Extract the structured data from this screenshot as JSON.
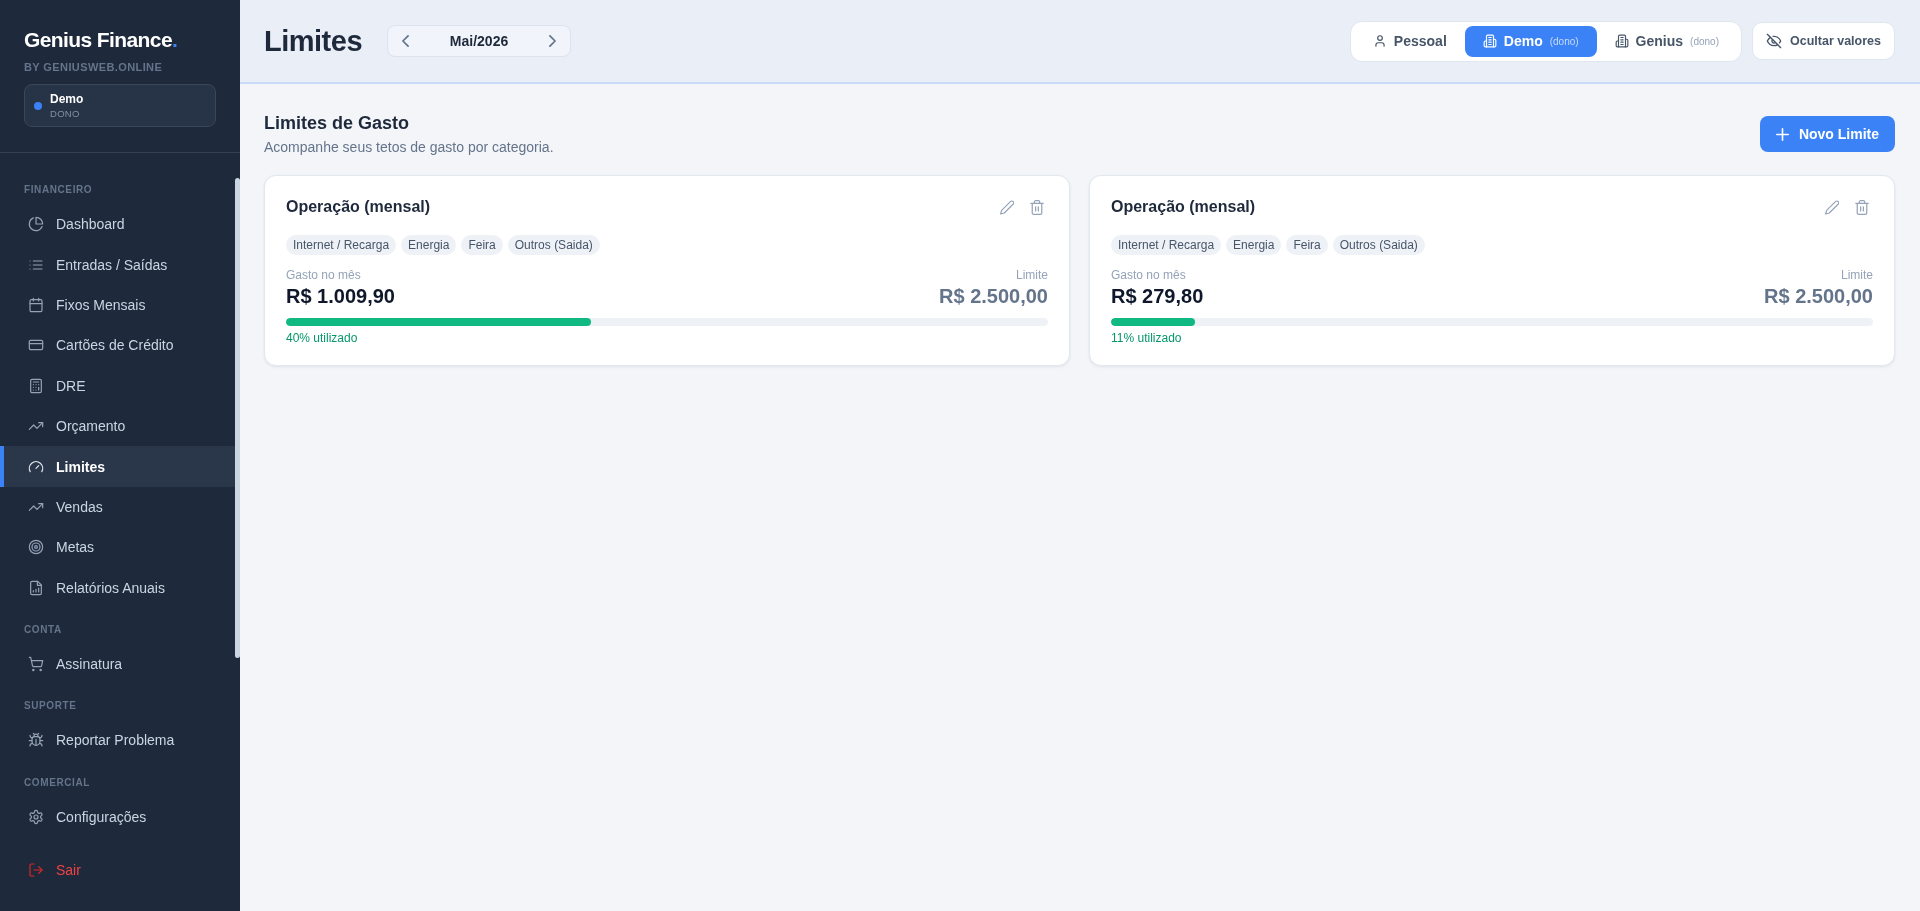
{
  "sidebar": {
    "brand": "Genius Finance",
    "brand_accent": ".",
    "tagline": "BY GENIUSWEB.ONLINE",
    "workspace": {
      "name": "Demo",
      "role": "DONO"
    },
    "sections": [
      {
        "title": "FINANCEIRO",
        "items": [
          {
            "label": "Dashboard",
            "selected": false
          },
          {
            "label": "Entradas / Saídas",
            "selected": false
          },
          {
            "label": "Fixos Mensais",
            "selected": false
          },
          {
            "label": "Cartões de Crédito",
            "selected": false
          },
          {
            "label": "DRE",
            "selected": false
          },
          {
            "label": "Orçamento",
            "selected": false
          },
          {
            "label": "Limites",
            "selected": true
          },
          {
            "label": "Vendas",
            "selected": false
          },
          {
            "label": "Metas",
            "selected": false
          },
          {
            "label": "Relatórios Anuais",
            "selected": false
          }
        ]
      },
      {
        "title": "CONTA",
        "items": [
          {
            "label": "Assinatura",
            "selected": false
          }
        ]
      },
      {
        "title": "SUPORTE",
        "items": [
          {
            "label": "Reportar Problema",
            "selected": false
          }
        ]
      },
      {
        "title": "COMERCIAL",
        "items": [
          {
            "label": "Configurações",
            "selected": false
          }
        ]
      }
    ],
    "logout": "Sair"
  },
  "header": {
    "title": "Limites",
    "month": "Mai/2026",
    "accounts": [
      {
        "kind": "personal",
        "label": "Pessoal",
        "selected": false
      },
      {
        "kind": "business",
        "label": "Demo",
        "note": "(dono)",
        "selected": true
      },
      {
        "kind": "business",
        "label": "Genius",
        "note": "(dono)",
        "selected": false
      }
    ],
    "hide_values": "Ocultar valores"
  },
  "content": {
    "title": "Limites de Gasto",
    "subtitle": "Acompanhe seus tetos de gasto por categoria.",
    "new_button": "Novo Limite",
    "limits": [
      {
        "name": "Operação (mensal)",
        "categories": [
          "Internet / Recarga",
          "Energia",
          "Feira",
          "Outros (Saida)"
        ],
        "spent_label": "Gasto no mês",
        "spent": "R$ 1.009,90",
        "limit_label": "Limite",
        "limit": "R$ 2.500,00",
        "level": 0.4,
        "usage": "40% utilizado"
      },
      {
        "name": "Operação (mensal)",
        "categories": [
          "Internet / Recarga",
          "Energia",
          "Feira",
          "Outros (Saida)"
        ],
        "spent_label": "Gasto no mês",
        "spent": "R$ 279,80",
        "limit_label": "Limite",
        "limit": "R$ 2.500,00",
        "level": 0.11,
        "usage": "11% utilizado"
      }
    ]
  }
}
